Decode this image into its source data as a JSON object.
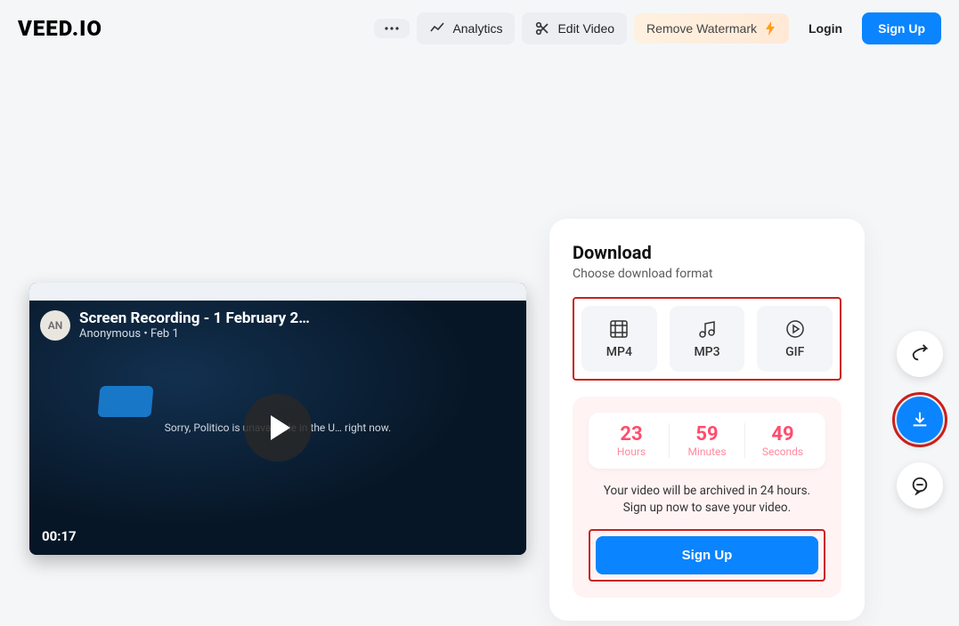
{
  "header": {
    "logo": "VEED.IO",
    "analytics": "Analytics",
    "edit": "Edit Video",
    "remove": "Remove Watermark",
    "login": "Login",
    "signup": "Sign Up"
  },
  "video": {
    "avatar": "AN",
    "title": "Screen Recording - 1 February 2…",
    "author": "Anonymous",
    "date": "Feb 1",
    "centerText": "Sorry, Politico is unavailable in the U… right now.",
    "timestamp": "00:17"
  },
  "download": {
    "title": "Download",
    "subtitle": "Choose download format",
    "formats": {
      "mp4": "MP4",
      "mp3": "MP3",
      "gif": "GIF"
    },
    "timer": {
      "hours_n": "23",
      "hours_l": "Hours",
      "minutes_n": "59",
      "minutes_l": "Minutes",
      "seconds_n": "49",
      "seconds_l": "Seconds"
    },
    "archive_line1": "Your video will be archived in 24 hours.",
    "archive_line2": "Sign up now to save your video.",
    "signup": "Sign Up"
  }
}
